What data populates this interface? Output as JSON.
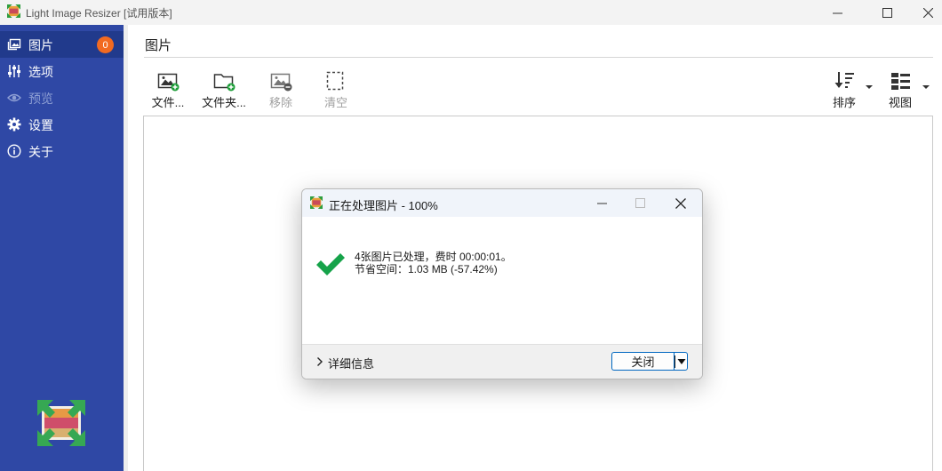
{
  "window": {
    "title": "Light Image Resizer  [试用版本]",
    "icons": {
      "app": "resizer-logo-icon",
      "minimize": "minimize-icon",
      "maximize": "maximize-icon",
      "close": "close-icon"
    }
  },
  "sidebar": {
    "items": [
      {
        "label": "图片",
        "icon": "images-icon",
        "badge": "0",
        "state": "active"
      },
      {
        "label": "选项",
        "icon": "sliders-icon",
        "state": "normal"
      },
      {
        "label": "预览",
        "icon": "eye-icon",
        "state": "disabled"
      },
      {
        "label": "设置",
        "icon": "gear-icon",
        "state": "normal"
      },
      {
        "label": "关于",
        "icon": "info-icon",
        "state": "normal"
      }
    ],
    "colors": {
      "background": "#2f48a5",
      "active": "#213a8c",
      "badge": "#f26a21"
    }
  },
  "main": {
    "title": "图片",
    "toolbar": {
      "file": "文件...",
      "folder": "文件夹...",
      "remove": "移除",
      "clear": "清空",
      "sort": "排序",
      "view": "视图"
    }
  },
  "dialog": {
    "title": "正在处理图片 - 100%",
    "message_line1": "4张图片已处理，费时 00:00:01。",
    "message_line2": "节省空间：1.03 MB (-57.42%)",
    "details_label": "详细信息",
    "close_label": "关闭",
    "colors": {
      "success": "#16a34a",
      "accent": "#0067c0"
    }
  }
}
